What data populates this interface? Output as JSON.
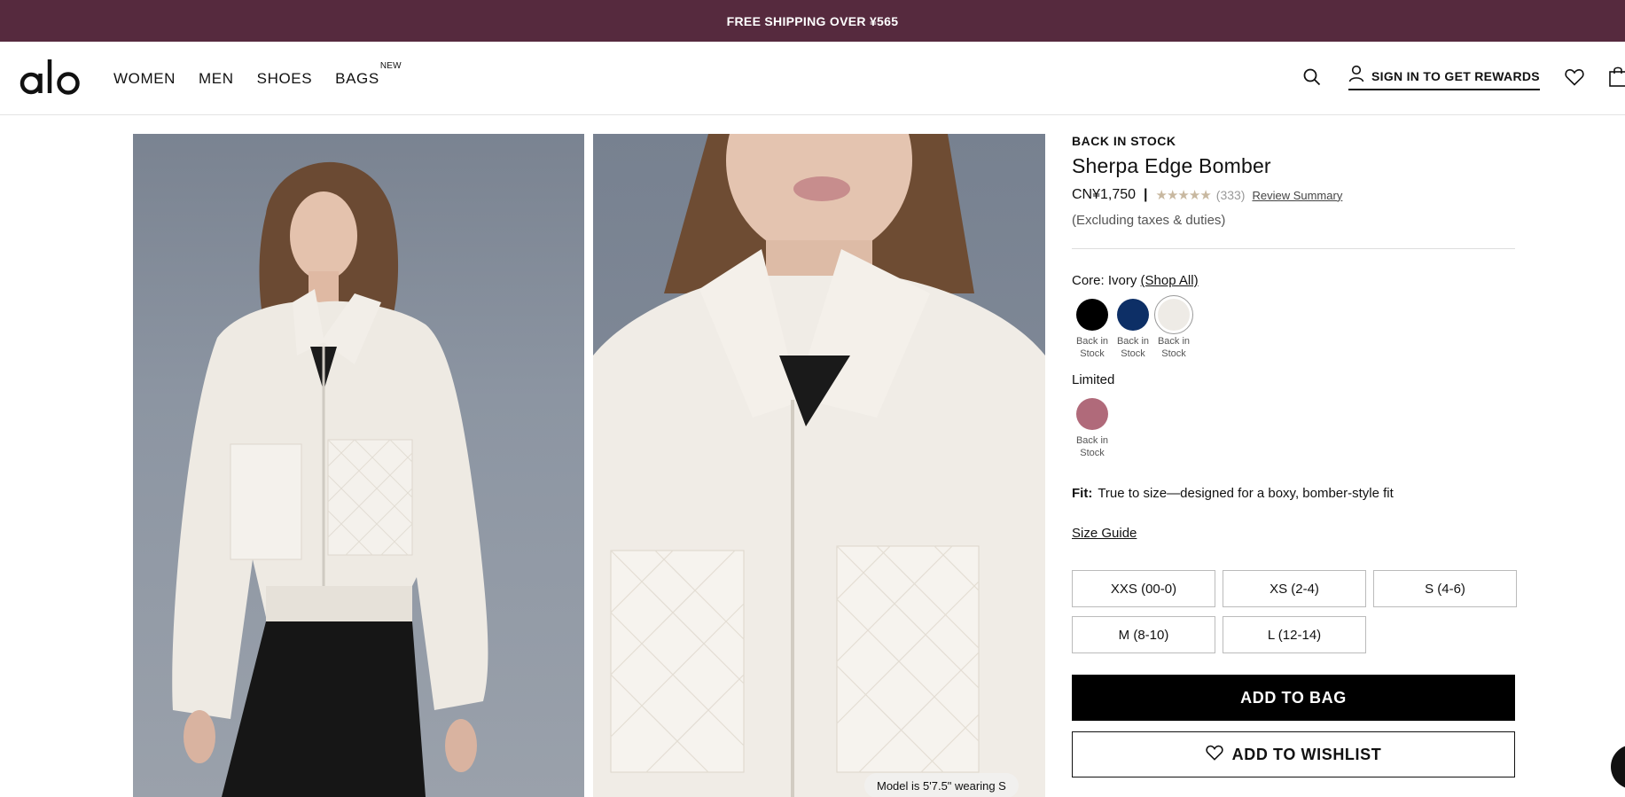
{
  "promo": {
    "text": "FREE SHIPPING OVER ¥565"
  },
  "header": {
    "logo_text": "alo",
    "nav": [
      {
        "label": "WOMEN"
      },
      {
        "label": "MEN"
      },
      {
        "label": "SHOES"
      },
      {
        "label": "BAGS",
        "badge": "NEW"
      }
    ],
    "sign_in_label": "SIGN IN TO GET REWARDS",
    "icons": [
      "search-icon",
      "user-icon",
      "heart-icon",
      "shopping-bag-icon"
    ]
  },
  "gallery": {
    "model_caption": "Model is 5'7.5\" wearing S"
  },
  "product": {
    "status": "BACK IN STOCK",
    "title": "Sherpa Edge Bomber",
    "price": "CN¥1,750",
    "separator": "|",
    "rating_stars": "★★★★★",
    "rating": 5,
    "review_count": "(333)",
    "review_summary_label": "Review Summary",
    "taxes_note": "(Excluding taxes & duties)",
    "core_label": "Core: Ivory",
    "shop_all_label": "(Shop All)",
    "core_swatches": [
      {
        "name": "Black",
        "color": "#000000",
        "caption_line1": "Back in",
        "caption_line2": "Stock"
      },
      {
        "name": "Navy",
        "color": "#0d2f66",
        "caption_line1": "Back in",
        "caption_line2": "Stock"
      },
      {
        "name": "Ivory",
        "color": "#eeebe6",
        "caption_line1": "Back in",
        "caption_line2": "Stock",
        "selected": true
      }
    ],
    "limited_label": "Limited",
    "limited_swatches": [
      {
        "name": "Mauve",
        "color": "#b06a7a",
        "caption_line1": "Back in",
        "caption_line2": "Stock"
      }
    ],
    "fit_label": "Fit:",
    "fit_text": "True to size—designed for a boxy, bomber-style fit",
    "size_guide_label": "Size Guide",
    "sizes": [
      "XXS (00-0)",
      "XS (2-4)",
      "S (4-6)",
      "M (8-10)",
      "L (12-14)"
    ],
    "add_to_bag_label": "ADD TO BAG",
    "add_to_wishlist_label": "ADD TO WISHLIST"
  },
  "colors": {
    "promo_bg": "#562a3e",
    "primary_button": "#000000"
  }
}
